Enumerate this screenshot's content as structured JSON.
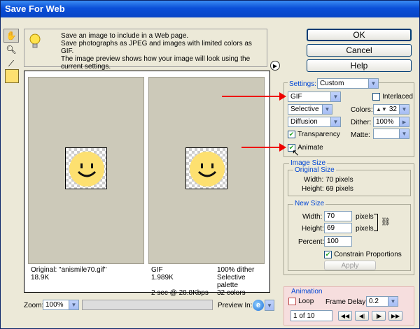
{
  "window": {
    "title": "Save For Web"
  },
  "info": {
    "line1": "Save an image to include in a Web page.",
    "line2": "Save photographs as JPEG and images with limited colors as GIF.",
    "line3": "The image preview shows how your image will look using the current settings."
  },
  "buttons": {
    "ok": "OK",
    "cancel": "Cancel",
    "help": "Help"
  },
  "preview": {
    "original": {
      "line1": "Original: \"anismile70.gif\"",
      "line2": "18.9K"
    },
    "optimized": {
      "left1": "GIF",
      "left2": "1.989K",
      "left3": "2 sec @ 28.8Kbps",
      "right1": "100% dither",
      "right2": "Selective palette",
      "right3": "32 colors"
    }
  },
  "bottom": {
    "zoom_label": "Zoom:",
    "zoom_value": "100%",
    "preview_in_label": "Preview In:"
  },
  "settings": {
    "label": "Settings:",
    "preset": "Custom",
    "format": "GIF",
    "interlaced": "Interlaced",
    "palette": "Selective",
    "colors_label": "Colors:",
    "colors_value": "32",
    "dither_type": "Diffusion",
    "dither_label": "Dither:",
    "dither_value": "100%",
    "transparency": "Transparency",
    "matte_label": "Matte:",
    "animate": "Animate"
  },
  "image_size": {
    "label": "Image Size",
    "original_label": "Original Size",
    "width_text": "Width: 70 pixels",
    "height_text": "Height: 69 pixels",
    "new_label": "New Size",
    "width_label": "Width:",
    "width_value": "70",
    "width_unit": "pixels",
    "height_label": "Height:",
    "height_value": "69",
    "height_unit": "pixels",
    "percent_label": "Percent:",
    "percent_value": "100",
    "constrain": "Constrain Proportions",
    "apply": "Apply"
  },
  "animation": {
    "label": "Animation",
    "loop": "Loop",
    "frame_delay_label": "Frame Delay:",
    "frame_delay_value": "0.2",
    "frame_counter": "1 of 10"
  }
}
